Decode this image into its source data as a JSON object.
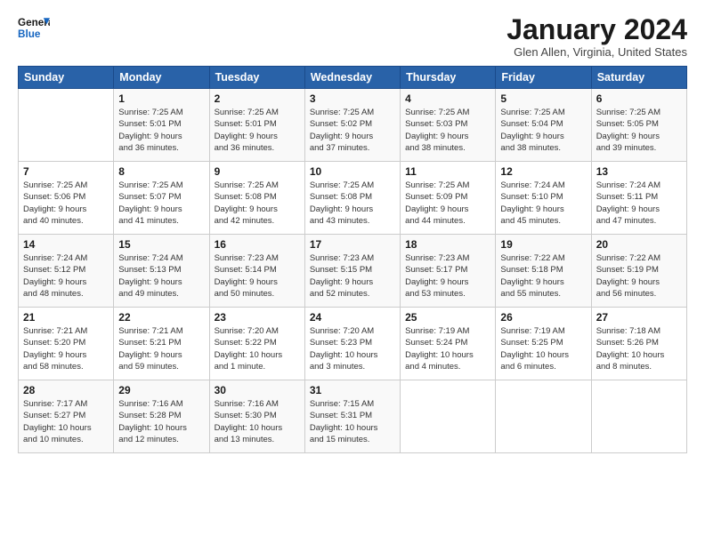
{
  "logo": {
    "line1": "General",
    "line2": "Blue"
  },
  "title": "January 2024",
  "location": "Glen Allen, Virginia, United States",
  "days_of_week": [
    "Sunday",
    "Monday",
    "Tuesday",
    "Wednesday",
    "Thursday",
    "Friday",
    "Saturday"
  ],
  "weeks": [
    [
      {
        "day": "",
        "info": ""
      },
      {
        "day": "1",
        "info": "Sunrise: 7:25 AM\nSunset: 5:01 PM\nDaylight: 9 hours\nand 36 minutes."
      },
      {
        "day": "2",
        "info": "Sunrise: 7:25 AM\nSunset: 5:01 PM\nDaylight: 9 hours\nand 36 minutes."
      },
      {
        "day": "3",
        "info": "Sunrise: 7:25 AM\nSunset: 5:02 PM\nDaylight: 9 hours\nand 37 minutes."
      },
      {
        "day": "4",
        "info": "Sunrise: 7:25 AM\nSunset: 5:03 PM\nDaylight: 9 hours\nand 38 minutes."
      },
      {
        "day": "5",
        "info": "Sunrise: 7:25 AM\nSunset: 5:04 PM\nDaylight: 9 hours\nand 38 minutes."
      },
      {
        "day": "6",
        "info": "Sunrise: 7:25 AM\nSunset: 5:05 PM\nDaylight: 9 hours\nand 39 minutes."
      }
    ],
    [
      {
        "day": "7",
        "info": "Sunrise: 7:25 AM\nSunset: 5:06 PM\nDaylight: 9 hours\nand 40 minutes."
      },
      {
        "day": "8",
        "info": "Sunrise: 7:25 AM\nSunset: 5:07 PM\nDaylight: 9 hours\nand 41 minutes."
      },
      {
        "day": "9",
        "info": "Sunrise: 7:25 AM\nSunset: 5:08 PM\nDaylight: 9 hours\nand 42 minutes."
      },
      {
        "day": "10",
        "info": "Sunrise: 7:25 AM\nSunset: 5:08 PM\nDaylight: 9 hours\nand 43 minutes."
      },
      {
        "day": "11",
        "info": "Sunrise: 7:25 AM\nSunset: 5:09 PM\nDaylight: 9 hours\nand 44 minutes."
      },
      {
        "day": "12",
        "info": "Sunrise: 7:24 AM\nSunset: 5:10 PM\nDaylight: 9 hours\nand 45 minutes."
      },
      {
        "day": "13",
        "info": "Sunrise: 7:24 AM\nSunset: 5:11 PM\nDaylight: 9 hours\nand 47 minutes."
      }
    ],
    [
      {
        "day": "14",
        "info": "Sunrise: 7:24 AM\nSunset: 5:12 PM\nDaylight: 9 hours\nand 48 minutes."
      },
      {
        "day": "15",
        "info": "Sunrise: 7:24 AM\nSunset: 5:13 PM\nDaylight: 9 hours\nand 49 minutes."
      },
      {
        "day": "16",
        "info": "Sunrise: 7:23 AM\nSunset: 5:14 PM\nDaylight: 9 hours\nand 50 minutes."
      },
      {
        "day": "17",
        "info": "Sunrise: 7:23 AM\nSunset: 5:15 PM\nDaylight: 9 hours\nand 52 minutes."
      },
      {
        "day": "18",
        "info": "Sunrise: 7:23 AM\nSunset: 5:17 PM\nDaylight: 9 hours\nand 53 minutes."
      },
      {
        "day": "19",
        "info": "Sunrise: 7:22 AM\nSunset: 5:18 PM\nDaylight: 9 hours\nand 55 minutes."
      },
      {
        "day": "20",
        "info": "Sunrise: 7:22 AM\nSunset: 5:19 PM\nDaylight: 9 hours\nand 56 minutes."
      }
    ],
    [
      {
        "day": "21",
        "info": "Sunrise: 7:21 AM\nSunset: 5:20 PM\nDaylight: 9 hours\nand 58 minutes."
      },
      {
        "day": "22",
        "info": "Sunrise: 7:21 AM\nSunset: 5:21 PM\nDaylight: 9 hours\nand 59 minutes."
      },
      {
        "day": "23",
        "info": "Sunrise: 7:20 AM\nSunset: 5:22 PM\nDaylight: 10 hours\nand 1 minute."
      },
      {
        "day": "24",
        "info": "Sunrise: 7:20 AM\nSunset: 5:23 PM\nDaylight: 10 hours\nand 3 minutes."
      },
      {
        "day": "25",
        "info": "Sunrise: 7:19 AM\nSunset: 5:24 PM\nDaylight: 10 hours\nand 4 minutes."
      },
      {
        "day": "26",
        "info": "Sunrise: 7:19 AM\nSunset: 5:25 PM\nDaylight: 10 hours\nand 6 minutes."
      },
      {
        "day": "27",
        "info": "Sunrise: 7:18 AM\nSunset: 5:26 PM\nDaylight: 10 hours\nand 8 minutes."
      }
    ],
    [
      {
        "day": "28",
        "info": "Sunrise: 7:17 AM\nSunset: 5:27 PM\nDaylight: 10 hours\nand 10 minutes."
      },
      {
        "day": "29",
        "info": "Sunrise: 7:16 AM\nSunset: 5:28 PM\nDaylight: 10 hours\nand 12 minutes."
      },
      {
        "day": "30",
        "info": "Sunrise: 7:16 AM\nSunset: 5:30 PM\nDaylight: 10 hours\nand 13 minutes."
      },
      {
        "day": "31",
        "info": "Sunrise: 7:15 AM\nSunset: 5:31 PM\nDaylight: 10 hours\nand 15 minutes."
      },
      {
        "day": "",
        "info": ""
      },
      {
        "day": "",
        "info": ""
      },
      {
        "day": "",
        "info": ""
      }
    ]
  ]
}
